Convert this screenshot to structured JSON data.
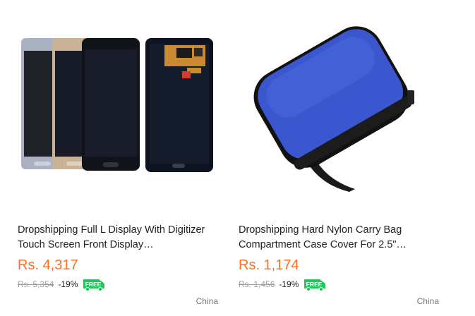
{
  "products": [
    {
      "title": "Dropshipping Full L Display With Digitizer Touch Screen Front Display…",
      "price": "Rs. 4,317",
      "original_price": "Rs. 5,354",
      "discount": "-19%",
      "shipping_badge": "FREE",
      "location": "China",
      "image_icon": "phone-screens-image"
    },
    {
      "title": "Dropshipping Hard Nylon Carry Bag Compartment Case Cover For 2.5\"…",
      "price": "Rs. 1,174",
      "original_price": "Rs. 1,456",
      "discount": "-19%",
      "shipping_badge": "FREE",
      "location": "China",
      "image_icon": "blue-case-image"
    }
  ],
  "colors": {
    "price": "#f57224",
    "free_badge": "#22c55e",
    "case_blue": "#3b57cf"
  }
}
